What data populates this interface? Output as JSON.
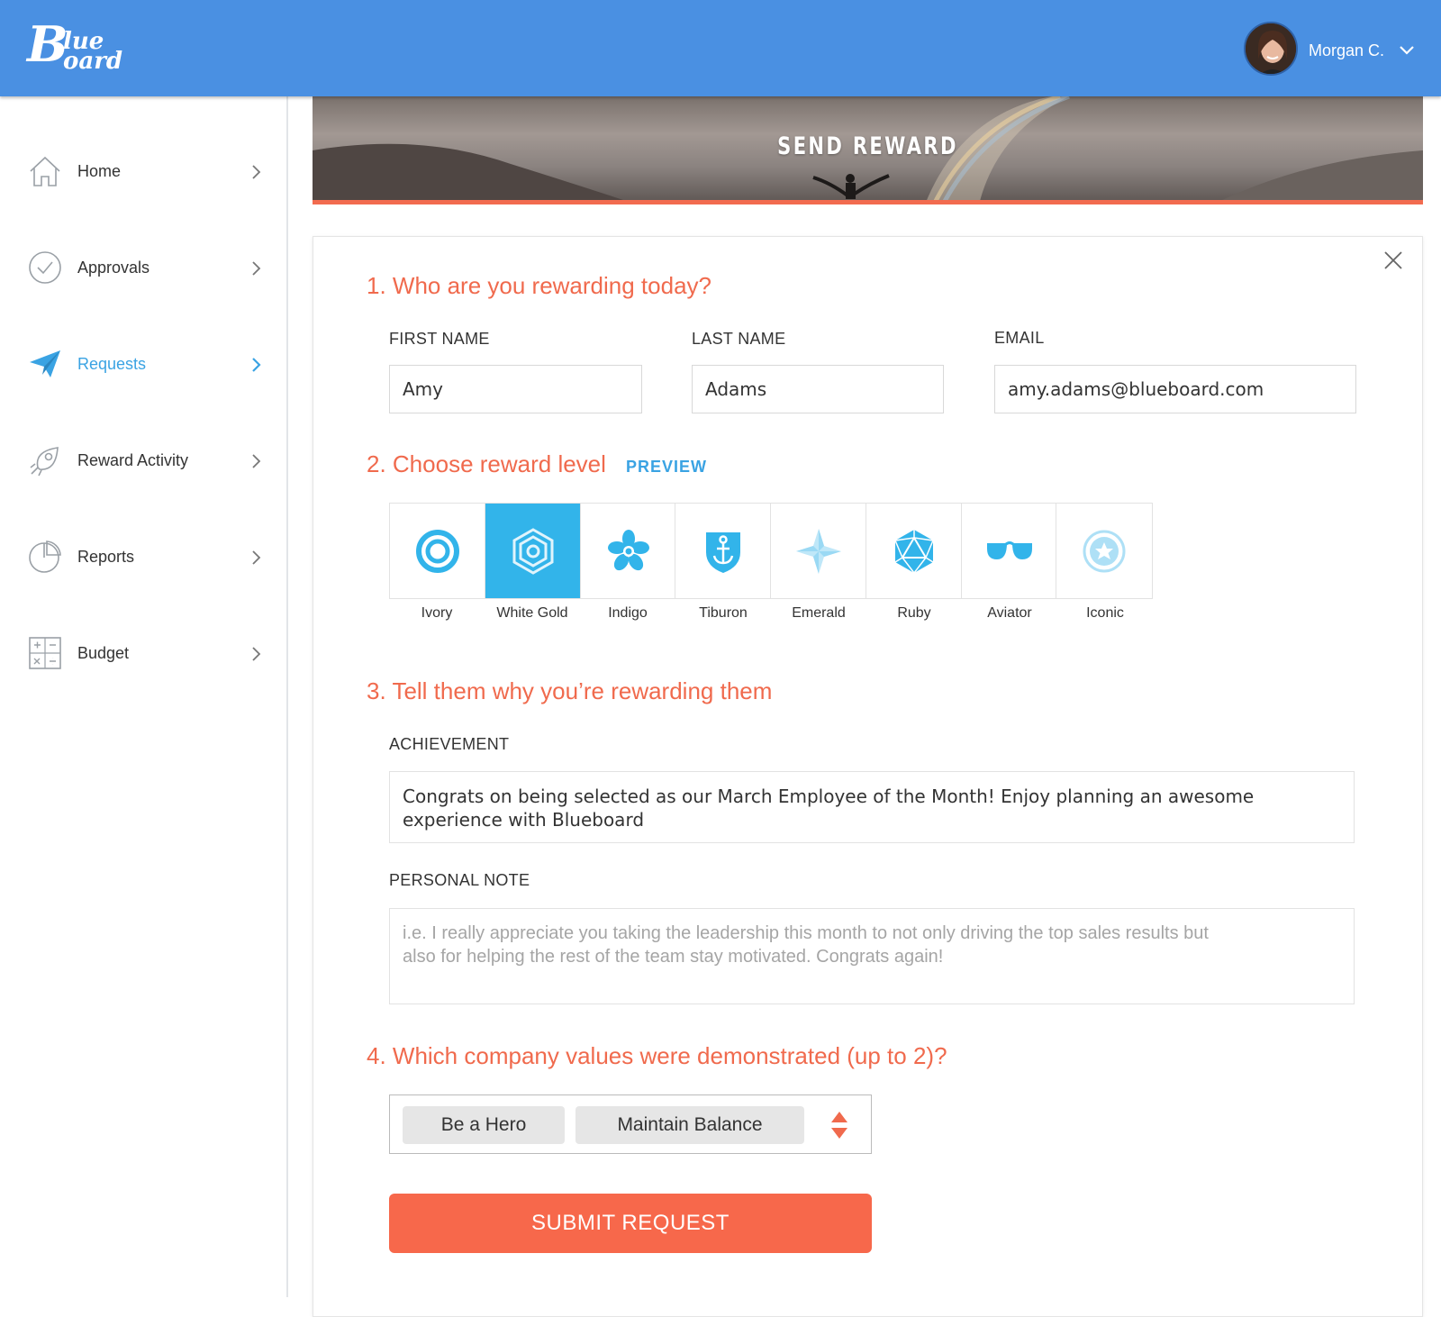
{
  "header": {
    "brand": "Blueboard",
    "user_name": "Morgan C."
  },
  "sidebar": {
    "items": [
      {
        "label": "Home",
        "icon": "home-icon",
        "active": false
      },
      {
        "label": "Approvals",
        "icon": "check-circle-icon",
        "active": false
      },
      {
        "label": "Requests",
        "icon": "paper-plane-icon",
        "active": true
      },
      {
        "label": "Reward Activity",
        "icon": "rocket-icon",
        "active": false
      },
      {
        "label": "Reports",
        "icon": "pie-chart-icon",
        "active": false
      },
      {
        "label": "Budget",
        "icon": "calculator-icon",
        "active": false
      }
    ]
  },
  "banner": {
    "title": "SEND REWARD"
  },
  "form": {
    "step1": {
      "title": "1. Who are you rewarding today?",
      "first_name_label": "FIRST NAME",
      "first_name_value": "Amy",
      "last_name_label": "LAST NAME",
      "last_name_value": "Adams",
      "email_label": "EMAIL",
      "email_value": "amy.adams@blueboard.com"
    },
    "step2": {
      "title": "2. Choose reward level",
      "preview_label": "PREVIEW",
      "selected": "White Gold",
      "levels": [
        {
          "label": "Ivory",
          "icon": "ring-icon"
        },
        {
          "label": "White Gold",
          "icon": "hexagon-icon"
        },
        {
          "label": "Indigo",
          "icon": "flower-icon"
        },
        {
          "label": "Tiburon",
          "icon": "anchor-shield-icon"
        },
        {
          "label": "Emerald",
          "icon": "sparkle-star-icon"
        },
        {
          "label": "Ruby",
          "icon": "gem-icon"
        },
        {
          "label": "Aviator",
          "icon": "sunglasses-icon"
        },
        {
          "label": "Iconic",
          "icon": "star-medal-icon"
        }
      ]
    },
    "step3": {
      "title": "3. Tell them why you’re rewarding them",
      "achievement_label": "ACHIEVEMENT",
      "achievement_value": "Congrats on being selected as our March Employee of the Month! Enjoy planning an awesome experience with Blueboard",
      "note_label": "PERSONAL NOTE",
      "note_placeholder": "i.e. I really appreciate you taking the leadership this month to not only driving the top sales results but also for helping the rest of the team stay motivated. Congrats again!"
    },
    "step4": {
      "title": "4. Which company values were demonstrated (up to 2)?",
      "selected_values": [
        "Be a Hero",
        "Maintain Balance"
      ]
    },
    "submit_label": "SUBMIT REQUEST"
  },
  "colors": {
    "header_blue": "#4a90e2",
    "accent_orange": "#f06a4d",
    "active_blue": "#3aa3e3",
    "selected_tile": "#32b4ea",
    "submit_bg": "#f7684b"
  }
}
